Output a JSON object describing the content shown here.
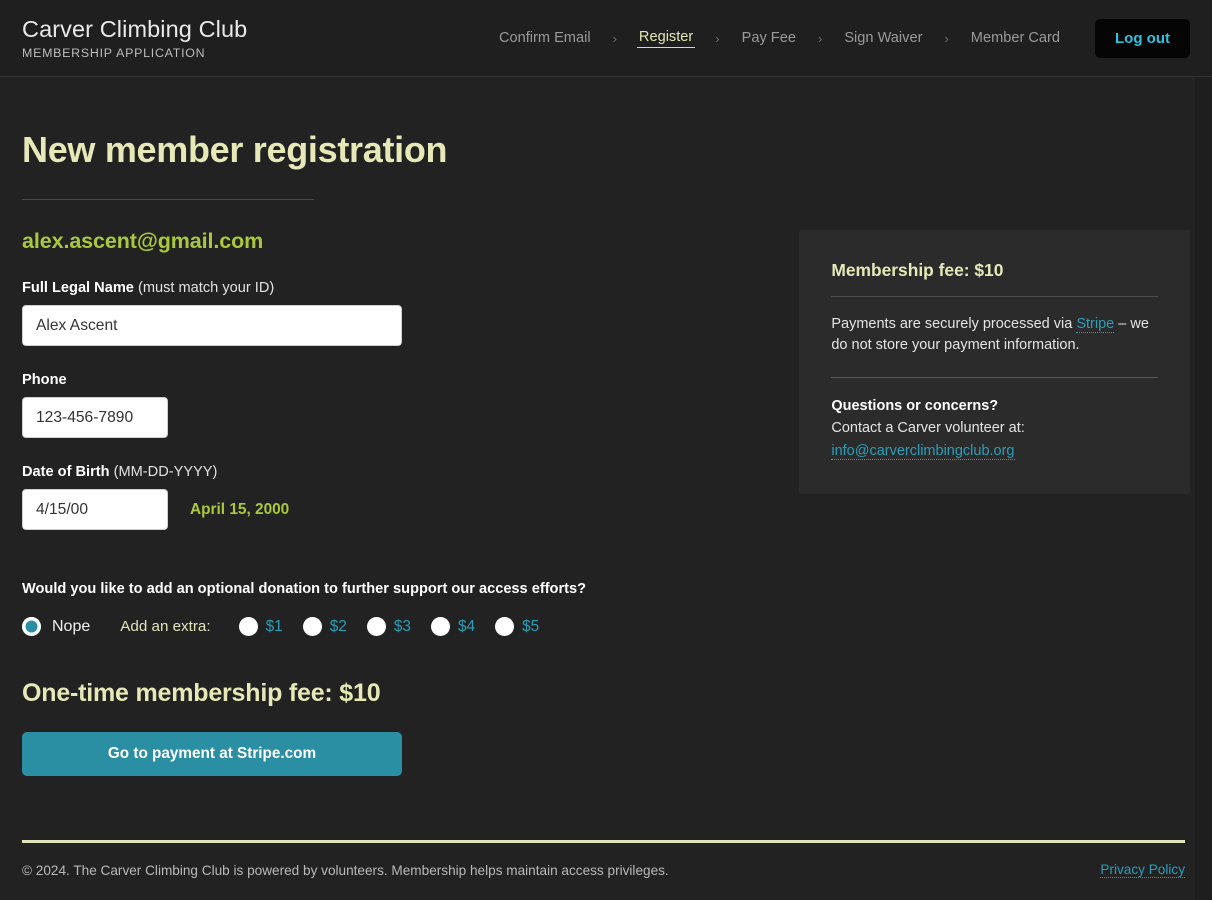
{
  "header": {
    "brand_title": "Carver Climbing Club",
    "brand_subtitle": "MEMBERSHIP APPLICATION",
    "nav_items": [
      {
        "label": "Confirm Email",
        "active": false
      },
      {
        "label": "Register",
        "active": true
      },
      {
        "label": "Pay Fee",
        "active": false
      },
      {
        "label": "Sign Waiver",
        "active": false
      },
      {
        "label": "Member Card",
        "active": false
      }
    ],
    "separator": "›",
    "logout_label": "Log out"
  },
  "main": {
    "page_title": "New member registration",
    "email": "alex.ascent@gmail.com",
    "fields": {
      "name": {
        "label": "Full Legal Name",
        "hint": "(must match your ID)",
        "value": "Alex Ascent",
        "placeholder": ""
      },
      "phone": {
        "label": "Phone",
        "hint": "",
        "value": "123-456-7890",
        "placeholder": ""
      },
      "dob": {
        "label": "Date of Birth",
        "hint": "(MM-DD-YYYY)",
        "value": "4/15/00",
        "placeholder": "",
        "parsed": "April 15, 2000"
      }
    },
    "donation": {
      "question": "Would you like to add an optional donation to further support our access efforts?",
      "none_label": "Nope",
      "none_selected": true,
      "extra_label": "Add an extra:",
      "amounts": [
        "$1",
        "$2",
        "$3",
        "$4",
        "$5"
      ]
    },
    "fee_heading": "One-time membership fee: $10",
    "pay_button": "Go to payment at Stripe.com"
  },
  "sidebar": {
    "card_title": "Membership fee: $10",
    "payment_text_before": "Payments are securely processed via ",
    "payment_link": "Stripe",
    "payment_text_after": " – we do not store your payment information.",
    "questions_title": "Questions or concerns?",
    "contact_text": "Contact a Carver volunteer at:",
    "contact_email": "info@carverclimbingclub.org"
  },
  "footer": {
    "copyright": "© 2024. The Carver Climbing Club is powered by volunteers. Membership helps maintain access privileges.",
    "privacy_label": "Privacy Policy"
  },
  "colors": {
    "accent_cream": "#e6e9b7",
    "accent_green": "#a9c83e",
    "accent_teal": "#2b9eb8",
    "button_teal": "#2b8fa3",
    "logout_cyan": "#2fc3dd",
    "page_bg": "#222222",
    "header_bg": "#1f1f1f",
    "card_bg": "#2b2b2b"
  }
}
